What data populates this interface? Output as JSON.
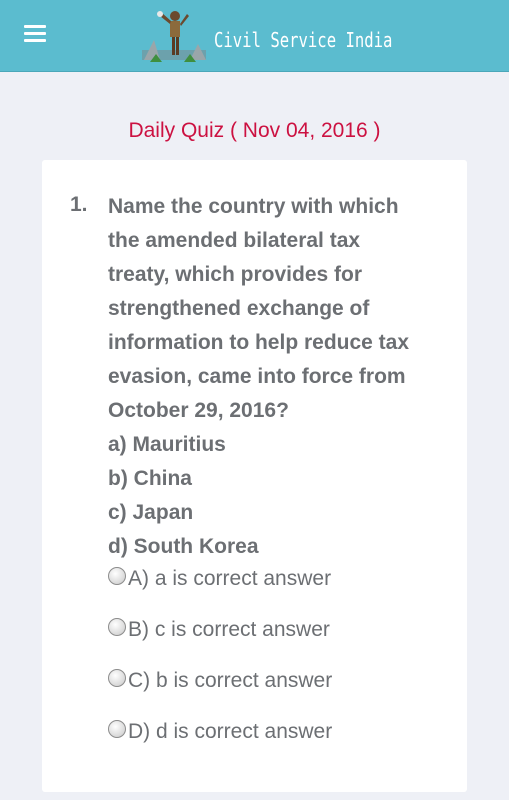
{
  "header": {
    "site_name": "Civil Service India",
    "menu_icon": "hamburger-menu-icon",
    "background_color": "#5bbccf"
  },
  "quiz": {
    "title": "Daily Quiz ( Nov 04, 2016 )",
    "title_color": "#cc1141",
    "question_number": "1.",
    "question_lines": [
      "Name the country with which",
      "the amended bilateral tax",
      "treaty, which provides for",
      "strengthened exchange of",
      "information to help reduce tax",
      "evasion, came into force from",
      "October 29, 2016?"
    ],
    "options": [
      "a) Mauritius",
      "b) China",
      "c) Japan",
      "d) South Korea"
    ],
    "answers": [
      {
        "label": "A) a is correct answer",
        "selected": false
      },
      {
        "label": "B) c is correct answer",
        "selected": false
      },
      {
        "label": "C) b is correct answer",
        "selected": false
      },
      {
        "label": "D) d is correct answer",
        "selected": false
      }
    ]
  }
}
